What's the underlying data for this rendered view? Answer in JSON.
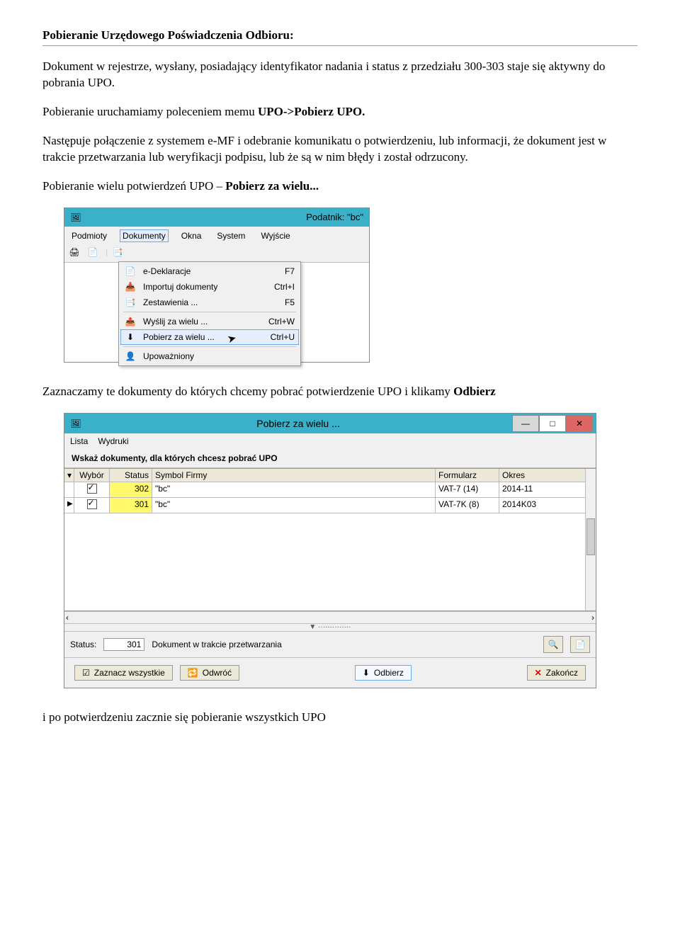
{
  "doc": {
    "heading": "Pobieranie Urzędowego Poświadczenia Odbioru:",
    "p1": "Dokument w rejestrze, wysłany, posiadający identyfikator nadania i status z przedziału 300-303 staje się aktywny do pobrania UPO.",
    "p2_pre": "Pobieranie uruchamiamy poleceniem memu ",
    "p2_bold": "UPO->Pobierz UPO.",
    "p3": "Następuje połączenie z systemem e-MF i odebranie komunikatu o potwierdzeniu, lub informacji, że dokument jest w trakcie przetwarzania lub weryfikacji podpisu, lub że są w nim błędy i został odrzucony.",
    "p4_pre": "Pobieranie wielu potwierdzeń UPO – ",
    "p4_bold": "Pobierz za wielu...",
    "p5_a": "Zaznaczamy te dokumenty do których chcemy pobrać potwierdzenie UPO i klikamy ",
    "p5_b": "Odbierz",
    "p6": "i po potwierdzeniu zacznie się pobieranie wszystkich UPO"
  },
  "app1": {
    "title": "Podatnik: \"bc\"",
    "menubar": [
      "Podmioty",
      "Dokumenty",
      "Okna",
      "System",
      "Wyjście"
    ],
    "dropdown": [
      {
        "label": "e-Deklaracje",
        "shortcut": "F7"
      },
      {
        "label": "Importuj dokumenty",
        "shortcut": "Ctrl+I"
      },
      {
        "label": "Zestawienia ...",
        "shortcut": "F5"
      },
      {
        "label": "Wyślij za wielu ...",
        "shortcut": "Ctrl+W"
      },
      {
        "label": "Pobierz za wielu ...",
        "shortcut": "Ctrl+U"
      },
      {
        "label": "Upoważniony",
        "shortcut": ""
      }
    ]
  },
  "app2": {
    "title": "Pobierz za wielu ...",
    "menubar": [
      "Lista",
      "Wydruki"
    ],
    "instruction": "Wskaż dokumenty, dla których chcesz pobrać UPO",
    "columns": [
      "",
      "Wybór",
      "Status",
      "Symbol Firmy",
      "Formularz",
      "Okres"
    ],
    "rows": [
      {
        "mark": "",
        "checked": true,
        "status": "302",
        "firm": "\"bc\"",
        "form": "VAT-7 (14)",
        "okres": "2014-11"
      },
      {
        "mark": "▶",
        "checked": true,
        "status": "301",
        "firm": "\"bc\"",
        "form": "VAT-7K (8)",
        "okres": "2014K03"
      }
    ],
    "status_label": "Status:",
    "status_value": "301",
    "status_text": "Dokument w trakcie przetwarzania",
    "buttons": {
      "select_all": "Zaznacz wszystkie",
      "invert": "Odwróć",
      "receive": "Odbierz",
      "close": "Zakończ"
    }
  }
}
